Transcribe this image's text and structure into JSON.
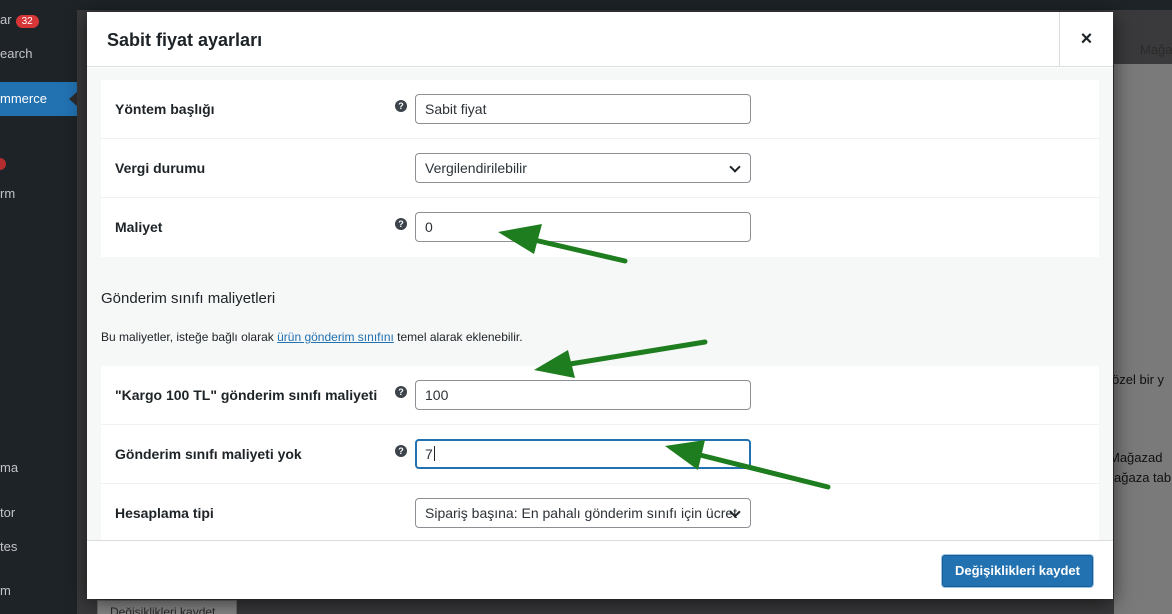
{
  "admin": {
    "sidebar": [
      {
        "text": "ar",
        "badge": "32"
      },
      {
        "text": "earch"
      },
      {
        "text": "mmerce"
      },
      {
        "text": "rm"
      },
      {
        "text": "ma"
      },
      {
        "text": "tor"
      },
      {
        "text": "tes"
      },
      {
        "text": "m"
      }
    ],
    "right_texts": [
      "Mağaz",
      "özel bir y",
      "Mağazad",
      "ağaza tab"
    ],
    "bottom_button": "Değişiklikleri kaydet"
  },
  "modal": {
    "title": "Sabit fiyat ayarları",
    "close_icon": "×",
    "help_icon": "?",
    "rows": {
      "method_title": {
        "label": "Yöntem başlığı",
        "value": "Sabit fiyat"
      },
      "tax_status": {
        "label": "Vergi durumu",
        "value": "Vergilendirilebilir"
      },
      "cost": {
        "label": "Maliyet",
        "value": "0"
      }
    },
    "section": {
      "title": "Gönderim sınıfı maliyetleri",
      "desc_before": "Bu maliyetler, isteğe bağlı olarak ",
      "desc_link": "ürün gönderim sınıfını",
      "desc_after": " temel alarak eklenebilir."
    },
    "class_rows": {
      "kargo": {
        "label": "\"Kargo 100 TL\" gönderim sınıfı maliyeti",
        "value": "100"
      },
      "no_class": {
        "label": "Gönderim sınıfı maliyeti yok",
        "value": "7"
      },
      "calc_type": {
        "label": "Hesaplama tipi",
        "value": "Sipariş başına: En pahalı gönderim sınıfı için ücret"
      }
    },
    "save_button": "Değişiklikleri kaydet"
  },
  "colors": {
    "accent": "#2271b1",
    "annotation_arrow": "#1e7d1e"
  }
}
